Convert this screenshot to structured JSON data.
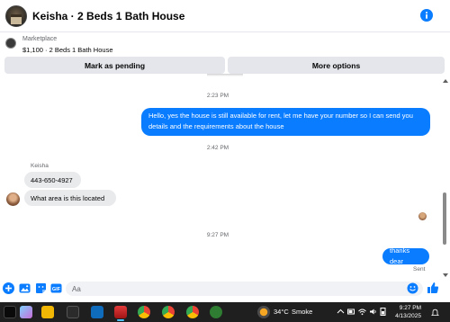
{
  "header": {
    "title": "Keisha · 2 Beds 1 Bath House",
    "info_icon": "info-icon"
  },
  "listing": {
    "label": "Marketplace",
    "detail": "$1,100 · 2 Beds 1 Bath House",
    "pending_button": "Mark as pending",
    "more_button": "More options"
  },
  "chat": {
    "messages": [
      {
        "type": "timestamp",
        "text": "2:23 PM"
      },
      {
        "type": "outgoing",
        "text": "Hello, yes the house is still available for rent, let me have your number so I can send you details and the requirements about the house"
      },
      {
        "type": "timestamp",
        "text": "2:42 PM"
      },
      {
        "type": "sender",
        "text": "Keisha"
      },
      {
        "type": "incoming",
        "text": "443-650-4927"
      },
      {
        "type": "incoming",
        "text": "What area is this located"
      },
      {
        "type": "timestamp",
        "text": "9:27 PM"
      },
      {
        "type": "outgoing",
        "text": "thanks dear"
      }
    ],
    "status": "Sent"
  },
  "composer": {
    "placeholder": "Aa",
    "value": "",
    "icons": [
      "plus-circle-icon",
      "image-icon",
      "sticker-icon",
      "gif-icon",
      "emoji-icon",
      "thumbs-up-icon"
    ]
  },
  "taskbar": {
    "weather": {
      "temp": "34°C",
      "condition": "Smoke"
    },
    "clock": {
      "time": "9:27 PM",
      "date": "4/13/2025"
    }
  },
  "colors": {
    "accent": "#0a7cff",
    "incoming_bubble": "#e9eaec",
    "taskbar": "#1f1f1f"
  }
}
